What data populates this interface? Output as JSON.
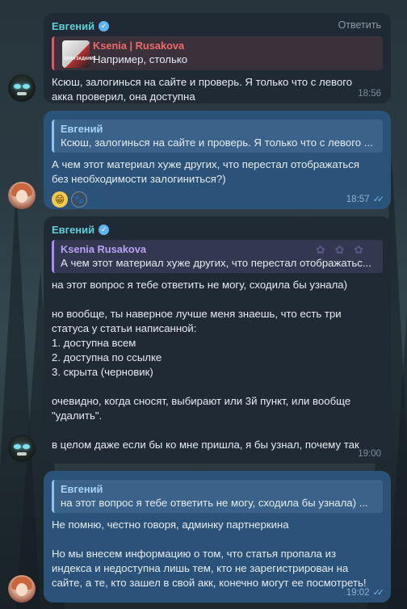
{
  "messages": [
    {
      "sender": "Евгений",
      "reply_button": "Ответить",
      "quote_name": "Ksenia | Rusakova",
      "quote_text": "Например, столько",
      "quote_thumb_caption": "ЗАЛИ ЗАДАНИЕ",
      "text": "Ксюш, залогинься на сайте и проверь. Я только что с левого акка проверил, она доступна",
      "time": "18:56"
    },
    {
      "quote_name": "Евгений",
      "quote_text": "Ксюш, залогинься на сайте и проверь. Я только что с левого ...",
      "text": "А чем этот материал хуже других, что перестал отображаться без необходимости залогиниться?)",
      "reactions": [
        "😁",
        "🐾"
      ],
      "time": "18:57"
    },
    {
      "sender": "Евгений",
      "quote_name": "Ksenia Rusakova",
      "quote_text": "А чем этот материал хуже других, что перестал отображатьс...",
      "text": "на этот вопрос я тебе ответить не могу, сходила бы узнала)\n\nно вообще, ты наверное лучше меня знаешь, что есть три статуса у статьи написанной:\n1. доступна всем\n2. доступна по ссылке\n3. скрыта (черновик)\n\nочевидно, когда сносят, выбирают или 3й пункт, или вообще \"удалить\".\n\nв целом даже если бы ко мне пришла, я бы узнал, почему так",
      "time": "19:00"
    },
    {
      "quote_name": "Евгений",
      "quote_text": "на этот вопрос я тебе ответить не могу, сходила бы узнала) ...",
      "text": "Не помню, честно говоря, админку партнеркина\n\nНо мы внесем информацию о том, что статья пропала из индекса и недоступна лишь тем, кто не зарегистрирован на сайте, а те, кто зашел в свой акк, конечно могут ее посмотреть!",
      "time": "19:02"
    }
  ],
  "colors": {
    "incoming_bubble": "#1f2a35",
    "outgoing_bubble": "#2b5278",
    "sender_name": "#5fd0d8",
    "read_ticks": "#6fb6f0"
  },
  "icons": {
    "verified": "verified-badge-icon",
    "read_status": "double-check-icon"
  }
}
